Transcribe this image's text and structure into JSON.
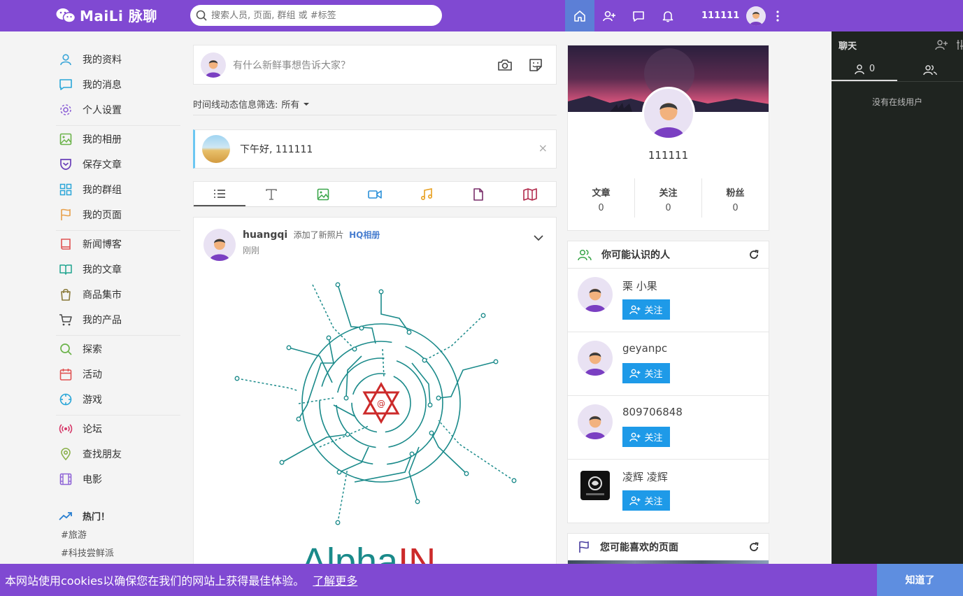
{
  "header": {
    "logo_text": "MaiLi 脉聊",
    "search_placeholder": "搜索人员, 页面, 群组 或 #标签",
    "username": "111111"
  },
  "sidebar": {
    "items": [
      {
        "label": "我的资料",
        "icon": "user-icon",
        "color": "#3aa6d8"
      },
      {
        "label": "我的消息",
        "icon": "message-icon",
        "color": "#2aa6d8"
      },
      {
        "label": "个人设置",
        "icon": "gear-icon",
        "color": "#8e63d6"
      },
      {
        "label": "我的相册",
        "icon": "image-icon",
        "color": "#6bb34a"
      },
      {
        "label": "保存文章",
        "icon": "pocket-icon",
        "color": "#6a3fb8"
      },
      {
        "label": "我的群组",
        "icon": "grid-icon",
        "color": "#2aa6d8"
      },
      {
        "label": "我的页面",
        "icon": "flag-icon",
        "color": "#e8a04a"
      },
      {
        "label": "新闻博客",
        "icon": "book-icon",
        "color": "#e05353"
      },
      {
        "label": "我的文章",
        "icon": "open-book-icon",
        "color": "#1fa48f"
      },
      {
        "label": "商品集市",
        "icon": "shopping-bag-icon",
        "color": "#8a7a3a"
      },
      {
        "label": "我的产品",
        "icon": "cart-icon",
        "color": "#4a4a4a"
      },
      {
        "label": "探索",
        "icon": "search-icon",
        "color": "#6bb34a"
      },
      {
        "label": "活动",
        "icon": "calendar-icon",
        "color": "#e05353"
      },
      {
        "label": "游戏",
        "icon": "crosshair-icon",
        "color": "#2aa6d8"
      },
      {
        "label": "论坛",
        "icon": "broadcast-icon",
        "color": "#d63a6a"
      },
      {
        "label": "查找朋友",
        "icon": "location-pin-icon",
        "color": "#8ab04a"
      },
      {
        "label": "电影",
        "icon": "film-icon",
        "color": "#8e63d6"
      }
    ],
    "hot_title": "热门！",
    "hot_tags": [
      "#旅游",
      "#科技尝鲜派"
    ]
  },
  "composer": {
    "placeholder": "有什么新鲜事想告诉大家？"
  },
  "filter": {
    "label": "时间线动态信息筛选:",
    "value": "所有"
  },
  "greeting": {
    "text": "下午好, 111111",
    "close": "×"
  },
  "post": {
    "user": "huangqi",
    "action": "添加了新照片",
    "album": "HQ相册",
    "time": "刚刚",
    "image_text": "AlphaIN",
    "image_text_a": "Alpha",
    "image_text_b": "IN"
  },
  "profile": {
    "name": "111111",
    "stats": [
      {
        "label": "文章",
        "value": "0"
      },
      {
        "label": "关注",
        "value": "0"
      },
      {
        "label": "粉丝",
        "value": "0"
      }
    ]
  },
  "suggest": {
    "title": "你可能认识的人",
    "follow_label": "关注",
    "people": [
      {
        "name": "栗 小果"
      },
      {
        "name": "geyanpc"
      },
      {
        "name": "809706848"
      },
      {
        "name": "凌辉 凌辉"
      }
    ]
  },
  "pages": {
    "title": "您可能喜欢的页面"
  },
  "chat": {
    "title": "聊天",
    "online_count": "0",
    "empty": "没有在线用户"
  },
  "cookie": {
    "text": "本网站使用cookies以确保您在我们的网站上获得最佳体验。",
    "link": "了解更多",
    "button": "知道了"
  }
}
